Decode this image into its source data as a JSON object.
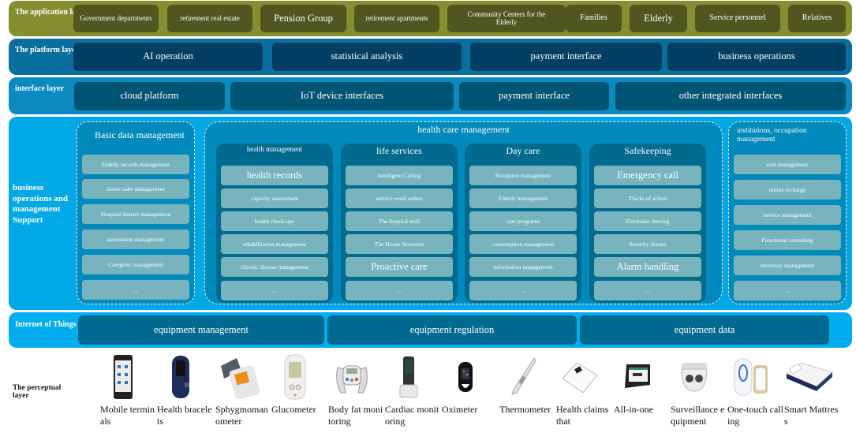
{
  "application_layer": {
    "label": "The application layer",
    "items": [
      "Government departments",
      "retirement real estate",
      "Pension Group",
      "retirement apartments",
      "Community Centers for the Elderly",
      "Families",
      "Elderly",
      "Service personnel",
      "Relatives"
    ]
  },
  "platform_layer": {
    "label": "The platform layer",
    "items": [
      "AI operation",
      "statistical analysis",
      "payment interface",
      "business operations"
    ]
  },
  "interface_layer": {
    "label": "interface layer",
    "items": [
      "cloud platform",
      "IoT device interfaces",
      "payment interface",
      "other integrated interfaces"
    ]
  },
  "business_layer": {
    "label": "business operations and management Support",
    "basic_data": {
      "title": "Basic data management",
      "items": [
        "Elderly records management",
        "house state management",
        "Hospital district management",
        "assessment management",
        "Caregiver management",
        "..."
      ]
    },
    "health_care": {
      "title": "health care management",
      "groups": [
        {
          "title": "health management",
          "items": [
            "health records",
            "capacity assessment",
            "health check-ups",
            "rehabilitation management",
            "chronic disease management",
            "..."
          ]
        },
        {
          "title": "life services",
          "items": [
            "Intelligent Calling",
            "service work orders",
            "The hospital mall",
            "The House Accounts",
            "Proactive care",
            "..."
          ]
        },
        {
          "title": "Day care",
          "items": [
            "Reception management",
            "Elderly management",
            "care programs",
            "consumption management",
            "information management",
            "..."
          ]
        },
        {
          "title": "Safekeeping",
          "items": [
            "Emergency call",
            "Tracks of action",
            "Electronic fencing",
            "Security alarms",
            "Alarm handling",
            "..."
          ]
        }
      ]
    },
    "institutions": {
      "title": "institutions, occupation management",
      "items": [
        "cost management",
        "online recharge",
        "service management",
        "Functional caretaking",
        "inventory management",
        "..."
      ]
    }
  },
  "iot_layer": {
    "label": "Internet of Things Management",
    "items": [
      "equipment management",
      "equipment regulation",
      "equipment data"
    ]
  },
  "perceptual_layer": {
    "label": "The perceptual layer",
    "devices": [
      {
        "name": "Mobile terminals",
        "icon": "mobile-phone-icon"
      },
      {
        "name": "Health bracelets",
        "icon": "bracelet-icon"
      },
      {
        "name": "Sphygmomanometer",
        "icon": "blood-pressure-monitor-icon"
      },
      {
        "name": "Glucometer",
        "icon": "glucometer-icon"
      },
      {
        "name": "Body fat monitoring",
        "icon": "body-fat-monitor-icon"
      },
      {
        "name": "Cardiac monitoring",
        "icon": "cardiac-monitor-icon"
      },
      {
        "name": "Oximeter",
        "icon": "oximeter-icon"
      },
      {
        "name": "Thermometer",
        "icon": "thermometer-icon"
      },
      {
        "name": "Health claims that",
        "icon": "health-scale-icon"
      },
      {
        "name": "All-in-one",
        "icon": "all-in-one-terminal-icon"
      },
      {
        "name": "Surveillance equipment",
        "icon": "surveillance-camera-icon"
      },
      {
        "name": "One-touch calling",
        "icon": "call-button-icon"
      },
      {
        "name": "Smart Mattress",
        "icon": "smart-mattress-icon"
      }
    ]
  }
}
